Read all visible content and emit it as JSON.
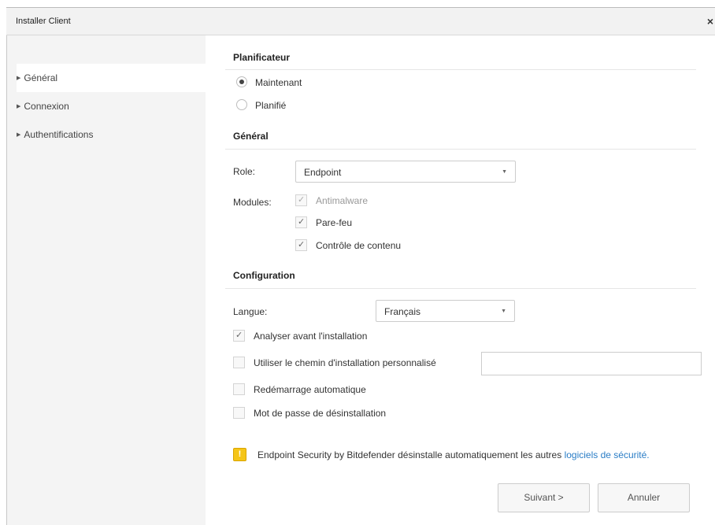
{
  "window": {
    "title": "Installer Client",
    "close_icon": "×"
  },
  "sidebar": {
    "items": [
      {
        "label": "Général",
        "active": true
      },
      {
        "label": "Connexion",
        "active": false
      },
      {
        "label": "Authentifications",
        "active": false
      }
    ]
  },
  "scheduler": {
    "heading": "Planificateur",
    "options": [
      {
        "label": "Maintenant",
        "selected": true
      },
      {
        "label": "Planifié",
        "selected": false
      }
    ]
  },
  "general": {
    "heading": "Général",
    "role_label": "Role:",
    "role_value": "Endpoint",
    "modules_label": "Modules:",
    "modules": [
      {
        "label": "Antimalware",
        "checked": true,
        "disabled": true
      },
      {
        "label": "Pare-feu",
        "checked": true,
        "disabled": false
      },
      {
        "label": "Contrôle de contenu",
        "checked": true,
        "disabled": false
      }
    ]
  },
  "configuration": {
    "heading": "Configuration",
    "language_label": "Langue:",
    "language_value": "Français",
    "options": [
      {
        "label": "Analyser avant l'installation",
        "checked": true
      },
      {
        "label": "Utiliser le chemin d'installation personnalisé",
        "checked": false
      },
      {
        "label": "Redémarrage automatique",
        "checked": false
      },
      {
        "label": "Mot de passe de désinstallation",
        "checked": false
      }
    ],
    "custom_path_value": ""
  },
  "notice": {
    "text": "Endpoint Security by Bitdefender désinstalle automatiquement les autres ",
    "link": "logiciels de sécurité."
  },
  "buttons": {
    "next": "Suivant >",
    "cancel": "Annuler"
  },
  "colors": {
    "link": "#2a7dc6",
    "warning": "#f5c518",
    "sidebar_bg": "#f4f4f4"
  }
}
